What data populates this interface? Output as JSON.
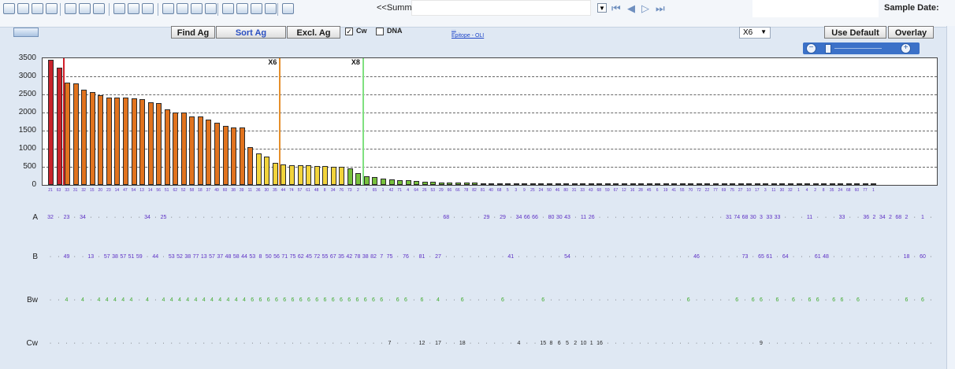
{
  "toolbar": {
    "summary_label": "<<Summa",
    "sample_date_label": "Sample Date:"
  },
  "controls": {
    "find_ag": "Find Ag",
    "sort_ag": "Sort Ag",
    "excl_ag": "Excl. Ag",
    "cw_label": "Cw",
    "cw_checked": true,
    "dna_label": "DNA",
    "dna_checked": false,
    "link_top": "...",
    "link_epitope": "Epitope - OLI",
    "x_select": "X6",
    "use_default": "Use Default",
    "overlay": "Overlay"
  },
  "colors": {
    "red": "#c9222b",
    "orange": "#e1731e",
    "yellow": "#f2d43b",
    "green": "#77c23c",
    "marker_red": "#d21f2a",
    "marker_orange": "#e58f2b",
    "marker_green": "#7fe07f",
    "label_purple": "#5d2fc4",
    "locus_green": "#3faa2c"
  },
  "chart_data": {
    "type": "bar",
    "ylim": [
      0,
      3500
    ],
    "yticks": [
      0,
      500,
      1000,
      1500,
      2000,
      2500,
      3000,
      3500
    ],
    "grid": true,
    "markers": [
      {
        "label": "",
        "after_index": 1
      },
      {
        "label": "X6",
        "after_index": 27
      },
      {
        "label": "X8",
        "after_index": 37
      }
    ],
    "bar_labels": [
      "21",
      "63",
      "33",
      "31",
      "32",
      "15",
      "20",
      "23",
      "14",
      "47",
      "54",
      "13",
      "14",
      "56",
      "51",
      "62",
      "52",
      "58",
      "18",
      "37",
      "49",
      "60",
      "38",
      "39",
      "11",
      "36",
      "30",
      "35",
      "44",
      "74",
      "57",
      "61",
      "48",
      "8",
      "34",
      "76",
      "73",
      "2",
      "7",
      "65",
      "1",
      "42",
      "71",
      "4",
      "64",
      "26",
      "53",
      "29",
      "66",
      "66",
      "78",
      "82",
      "81",
      "40",
      "68",
      "5",
      "3",
      "9",
      "25",
      "24",
      "50",
      "46",
      "80",
      "31",
      "33",
      "43",
      "68",
      "59",
      "67",
      "12",
      "16",
      "28",
      "45",
      "6",
      "19",
      "41",
      "55",
      "70",
      "72",
      "22",
      "77",
      "69",
      "75",
      "27",
      "10",
      "17",
      "3",
      "11",
      "30",
      "32",
      "1",
      "4",
      "2",
      "8",
      "35",
      "24",
      "68",
      "60",
      "77",
      "1"
    ],
    "values": [
      3450,
      3250,
      2830,
      2800,
      2620,
      2560,
      2470,
      2420,
      2420,
      2420,
      2400,
      2370,
      2290,
      2260,
      2090,
      2010,
      2010,
      1900,
      1890,
      1810,
      1720,
      1620,
      1590,
      1590,
      1050,
      880,
      780,
      600,
      560,
      550,
      550,
      540,
      530,
      520,
      510,
      500,
      450,
      320,
      250,
      220,
      180,
      160,
      140,
      120,
      100,
      90,
      80,
      75,
      70,
      65,
      60,
      55,
      50,
      50,
      45,
      45,
      40,
      40,
      38,
      36,
      34,
      32,
      30,
      30,
      30,
      30,
      30,
      30,
      30,
      30,
      30,
      30,
      30,
      30,
      30,
      30,
      30,
      30,
      30,
      30,
      30,
      30,
      30,
      30,
      30,
      30,
      30,
      30,
      30,
      30,
      30,
      30,
      30,
      30,
      30,
      30,
      30,
      30,
      30,
      30
    ]
  },
  "loci": {
    "rows": [
      {
        "label": "A",
        "color": "#5d2fc4",
        "marks": {
          "0": "32",
          "2": "23",
          "4": "34",
          "12": "34",
          "14": "25",
          "49": "68",
          "54": "29",
          "56": "29",
          "58": "34",
          "59": "66",
          "60": "66",
          "62": "80",
          "63": "30",
          "64": "43",
          "66": "11",
          "67": "26",
          "84": "31",
          "85": "74",
          "86": "68",
          "87": "30",
          "88": "3",
          "89": "33",
          "90": "33",
          "94": "11",
          "98": "33",
          "101": "36",
          "102": "2",
          "103": "34",
          "104": "2",
          "105": "68",
          "106": "2",
          "108": "1"
        }
      },
      {
        "label": "B",
        "color": "#5d2fc4",
        "marks": {
          "2": "49",
          "5": "13",
          "7": "57",
          "8": "38",
          "9": "57",
          "10": "51",
          "11": "59",
          "13": "44",
          "15": "53",
          "16": "52",
          "17": "38",
          "18": "77",
          "19": "13",
          "20": "57",
          "21": "37",
          "22": "48",
          "23": "58",
          "24": "44",
          "25": "53",
          "26": "8",
          "27": "50",
          "28": "56",
          "29": "71",
          "30": "75",
          "31": "62",
          "32": "45",
          "33": "72",
          "34": "55",
          "35": "67",
          "36": "35",
          "37": "42",
          "38": "78",
          "39": "38",
          "40": "82",
          "41": "7",
          "42": "75",
          "44": "76",
          "46": "81",
          "48": "27",
          "57": "41",
          "64": "54",
          "80": "46",
          "86": "73",
          "88": "65",
          "89": "61",
          "91": "64",
          "95": "61",
          "96": "48",
          "106": "18",
          "108": "60"
        }
      },
      {
        "label": "Bw",
        "color": "#3faa2c",
        "marks": {
          "2": "4",
          "4": "4",
          "6": "4",
          "7": "4",
          "8": "4",
          "9": "4",
          "10": "4",
          "12": "4",
          "14": "4",
          "15": "4",
          "16": "4",
          "17": "4",
          "18": "4",
          "19": "4",
          "20": "4",
          "21": "4",
          "22": "4",
          "23": "4",
          "24": "4",
          "25": "6",
          "26": "6",
          "27": "6",
          "28": "6",
          "29": "6",
          "30": "6",
          "31": "6",
          "32": "6",
          "33": "6",
          "34": "6",
          "35": "6",
          "36": "6",
          "37": "6",
          "38": "6",
          "39": "6",
          "40": "6",
          "41": "6",
          "43": "6",
          "44": "6",
          "46": "6",
          "48": "4",
          "51": "6",
          "56": "6",
          "61": "6",
          "79": "6",
          "85": "6",
          "87": "6",
          "88": "6",
          "90": "6",
          "92": "6",
          "94": "6",
          "95": "6",
          "97": "6",
          "98": "6",
          "100": "6",
          "106": "6",
          "108": "6"
        }
      },
      {
        "label": "Cw",
        "color": "#222222",
        "marks": {
          "42": "7",
          "46": "12",
          "48": "17",
          "51": "18",
          "58": "4",
          "61": "15",
          "62": "8",
          "63": "6",
          "64": "5",
          "65": "2",
          "66": "10",
          "67": "1",
          "68": "16",
          "88": "9"
        }
      }
    ]
  }
}
